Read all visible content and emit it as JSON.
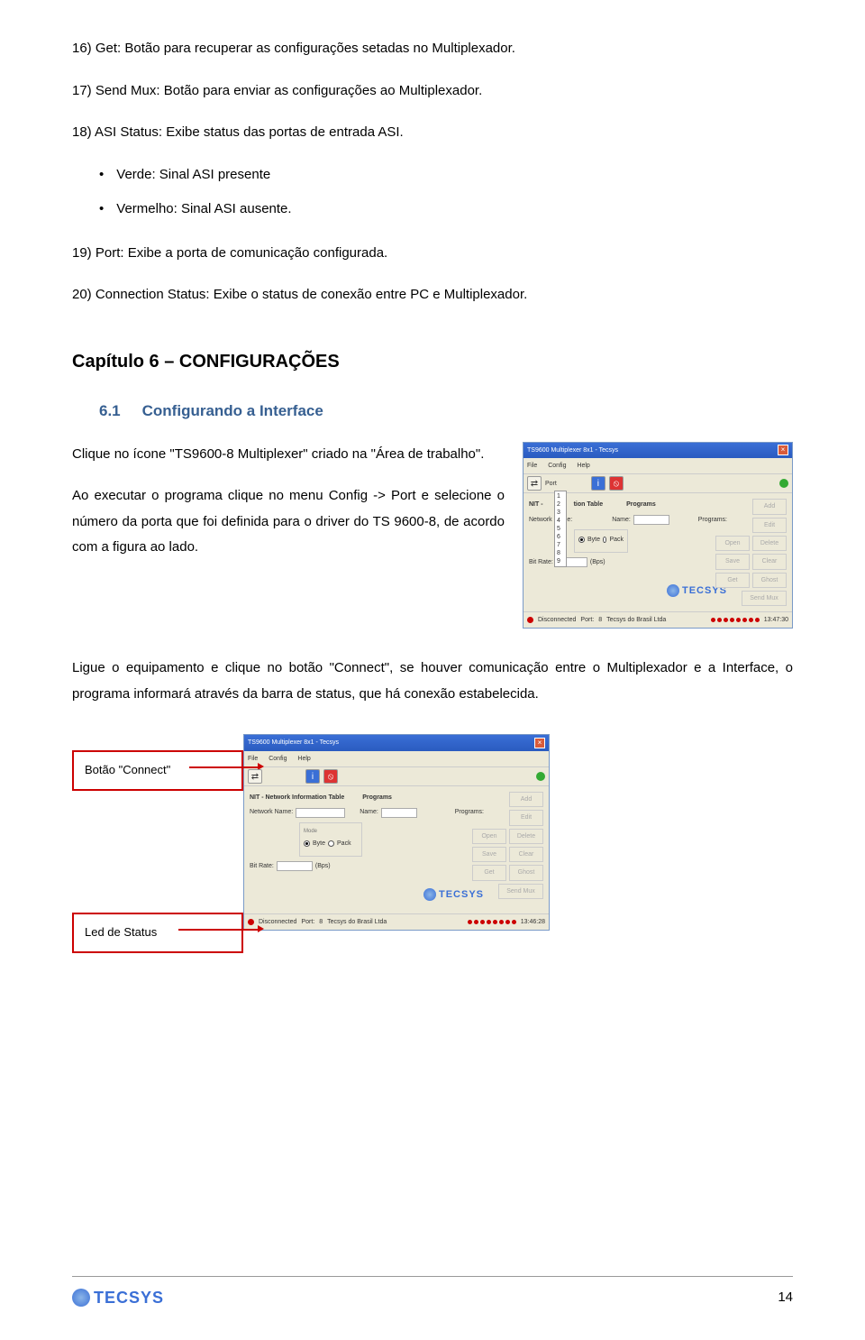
{
  "items": {
    "i16": "16) Get: Botão para recuperar as configurações setadas no Multiplexador.",
    "i17": "17) Send Mux: Botão para enviar as configurações ao Multiplexador.",
    "i18": "18) ASI Status: Exibe status das portas de entrada ASI.",
    "b1": "Verde: Sinal ASI presente",
    "b2": "Vermelho: Sinal ASI ausente.",
    "i19": "19) Port: Exibe a porta de comunicação configurada.",
    "i20": "20) Connection Status: Exibe o status de conexão entre PC e Multiplexador."
  },
  "chapter": "Capítulo 6 – CONFIGURAÇÕES",
  "sub": {
    "num": "6.1",
    "title": "Configurando a Interface"
  },
  "p1": "Clique no ícone \"TS9600-8 Multiplexer\" criado na \"Área de trabalho\".",
  "p2": "Ao executar o programa clique no menu Config -> Port e selecione o número da porta que foi definida para o driver do TS 9600-8, de acordo com a figura ao lado.",
  "p3": "Ligue o equipamento e clique no botão \"Connect\", se houver comunicação entre o Multiplexador e a Interface, o programa informará através da barra de status, que há conexão estabelecida.",
  "callouts": {
    "connect": "Botão \"Connect\"",
    "status": "Led de Status"
  },
  "app": {
    "title": "TS9600 Multiplexer 8x1 - Tecsys",
    "menu": {
      "file": "File",
      "config": "Config",
      "help": "Help"
    },
    "port_label": "Port",
    "ports": [
      "1",
      "2",
      "3",
      "4",
      "5",
      "6",
      "7",
      "8",
      "9"
    ],
    "nit_heading": "NIT - Network Information Table",
    "nit_heading_short": "NIT -",
    "nit_heading_mid": "tion Table",
    "network_name": "Network Name:",
    "mode": "Mode",
    "byte": "Byte",
    "pack": "Pack",
    "bit_rate": "Bit Rate:",
    "bps": "(Bps)",
    "programs_heading": "Programs",
    "name": "Name:",
    "programs_label": "Programs:",
    "buttons": {
      "add": "Add",
      "edit": "Edit",
      "open": "Open",
      "delete": "Delete",
      "save": "Save",
      "clear": "Clear",
      "get": "Get",
      "ghost": "Ghost",
      "sendmux": "Send Mux"
    },
    "status": {
      "disconnected": "Disconnected",
      "port": "Port:",
      "portn": "8",
      "company": "Tecsys do Brasil Ltda",
      "time1": "13:47:30",
      "time2": "13:46:28"
    },
    "logo_text": "TECSYS"
  },
  "footer": {
    "logo": "TECSYS",
    "page": "14"
  }
}
